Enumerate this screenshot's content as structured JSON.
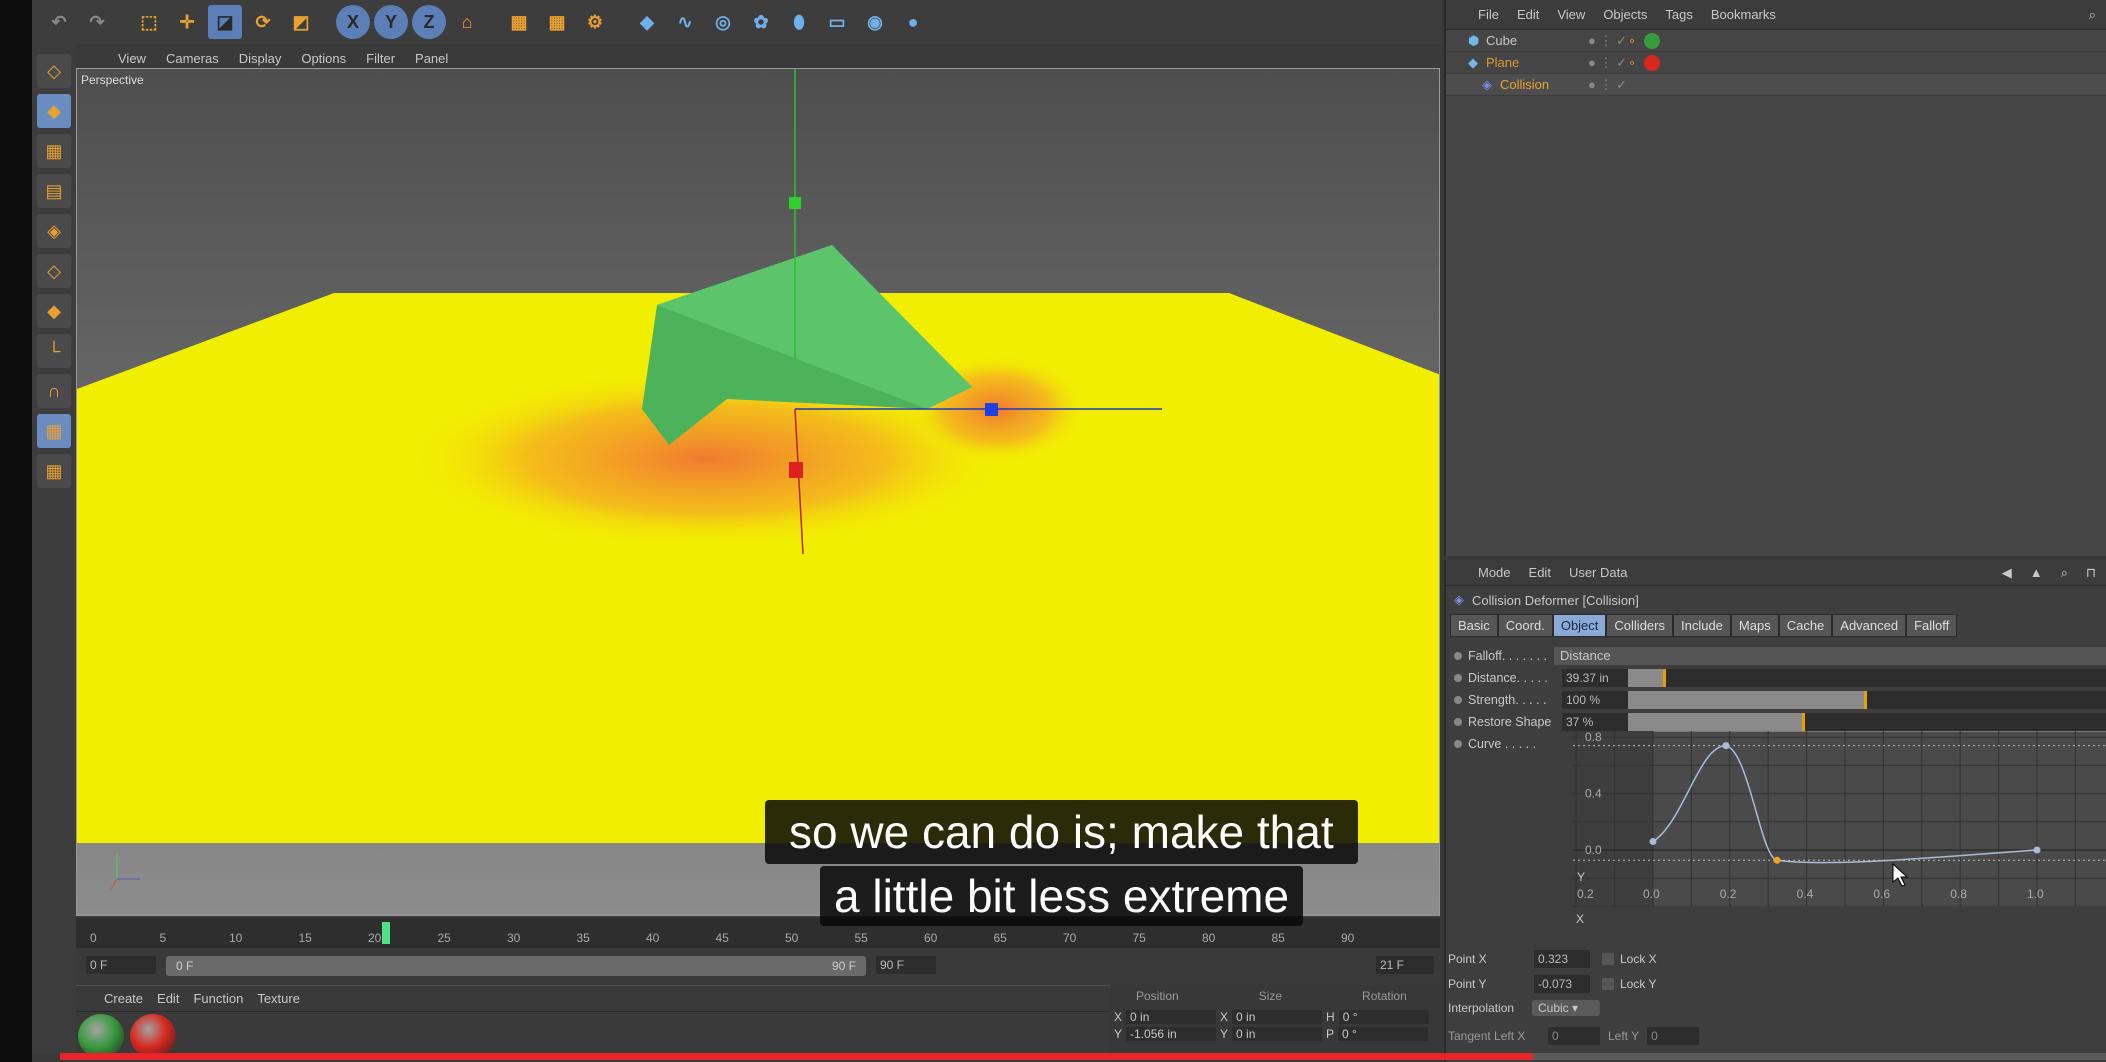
{
  "toolbar": {
    "icons": [
      "undo-icon",
      "redo-icon",
      "select-icon",
      "move-icon",
      "scale-icon",
      "rotate-icon",
      "last-tool-icon",
      "x-axis-icon",
      "y-axis-icon",
      "z-axis-icon",
      "coord-system-icon",
      "render-view-icon",
      "render-picture-viewer-icon",
      "render-settings-icon",
      "cube-primitive-icon",
      "spline-icon",
      "nurbs-icon",
      "array-icon",
      "deformer-icon",
      "floor-icon",
      "camera-icon",
      "light-icon"
    ],
    "axis_labels": [
      "X",
      "Y",
      "Z"
    ]
  },
  "left_tools": [
    "make-editable-icon",
    "model-mode-icon",
    "texture-mode-icon",
    "workplane-icon",
    "points-mode-icon",
    "edges-mode-icon",
    "polygons-mode-icon",
    "axis-mode-icon",
    "snap-icon",
    "locked-workplane-icon",
    "planar-workplane-icon"
  ],
  "viewport": {
    "menu": [
      "View",
      "Cameras",
      "Display",
      "Options",
      "Filter",
      "Panel"
    ],
    "label": "Perspective",
    "plane_color": "#f2ee00",
    "cube_color": "#4cb35a"
  },
  "timeline": {
    "ticks": [
      "0",
      "5",
      "10",
      "15",
      "20",
      "25",
      "30",
      "35",
      "40",
      "45",
      "50",
      "55",
      "60",
      "65",
      "70",
      "75",
      "80",
      "85",
      "90"
    ],
    "current_frame": 21,
    "current_frame_label": "21 F",
    "start_field": "0 F",
    "range_start": "0 F",
    "range_end": "90 F",
    "end_field": "90 F"
  },
  "materials": {
    "menu": [
      "Create",
      "Edit",
      "Function",
      "Texture"
    ],
    "items": [
      {
        "name": "green-material",
        "color": "#3a9a3e"
      },
      {
        "name": "red-material",
        "color": "#d8281e"
      }
    ]
  },
  "coords": {
    "headers": [
      "Position",
      "Size",
      "Rotation"
    ],
    "rows": [
      [
        "X",
        "0 in",
        "X",
        "0 in",
        "H",
        "0 °"
      ],
      [
        "Y",
        "-1.056 in",
        "Y",
        "0 in",
        "P",
        "0 °"
      ]
    ]
  },
  "object_manager": {
    "menu": [
      "File",
      "Edit",
      "View",
      "Objects",
      "Tags",
      "Bookmarks"
    ],
    "objects": [
      {
        "name": "Cube",
        "color": "#c8c8c8"
      },
      {
        "name": "Plane",
        "color": "#d89a30"
      },
      {
        "name": "Collision",
        "color": "#e8a030"
      }
    ]
  },
  "attributes": {
    "menu": [
      "Mode",
      "Edit",
      "User Data"
    ],
    "title": "Collision Deformer [Collision]",
    "tabs": [
      "Basic",
      "Coord.",
      "Object",
      "Colliders",
      "Include",
      "Maps",
      "Cache",
      "Advanced",
      "Falloff"
    ],
    "active_tab": "Object",
    "falloff": {
      "label": "Falloff. . . . . . .",
      "value": "Distance"
    },
    "distance": {
      "label": "Distance. . . . .",
      "value": "39.37 in",
      "fraction": 0.08
    },
    "strength": {
      "label": "Strength. . . . .",
      "value": "100 %",
      "fraction": 0.5
    },
    "restore": {
      "label": "Restore Shape",
      "value": "37 %",
      "fraction": 0.37
    },
    "curve_label": "Curve . . . . .",
    "curve": {
      "x_ticks": [
        "0.2",
        "0.0",
        "0.2",
        "0.4",
        "0.6",
        "0.8",
        "1.0"
      ],
      "y_ticks": [
        "0.8",
        "0.4",
        "0.0"
      ],
      "x_axis": "X",
      "y_axis": "Y",
      "points": [
        [
          0,
          0.06
        ],
        [
          0.19,
          0.74
        ],
        [
          0.323,
          -0.073
        ],
        [
          1.0,
          0.0
        ]
      ],
      "selected_point": 2
    },
    "point_x": {
      "label": "Point X",
      "value": "0.323"
    },
    "point_y": {
      "label": "Point Y",
      "value": "-0.073"
    },
    "lock_x": "Lock X",
    "lock_y": "Lock Y",
    "interp": {
      "label": "Interpolation",
      "value": "Cubic"
    },
    "tangent_left_x": {
      "label": "Tangent Left X",
      "value": "0"
    },
    "left_y": {
      "label": "Left Y",
      "value": "0"
    }
  },
  "subtitles": [
    "so we can do is; make that",
    "a little bit less extreme"
  ],
  "video_progress": 0.72
}
